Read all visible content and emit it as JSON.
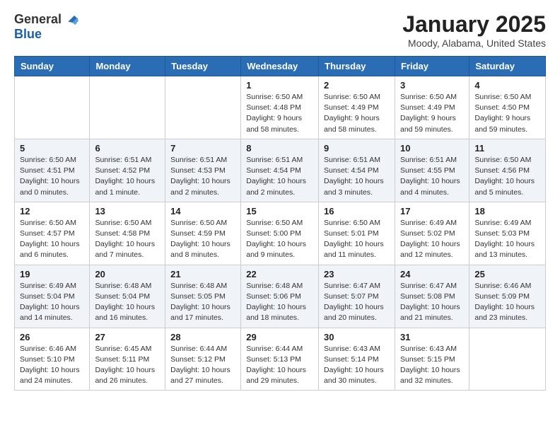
{
  "header": {
    "logo_general": "General",
    "logo_blue": "Blue",
    "title": "January 2025",
    "subtitle": "Moody, Alabama, United States"
  },
  "weekdays": [
    "Sunday",
    "Monday",
    "Tuesday",
    "Wednesday",
    "Thursday",
    "Friday",
    "Saturday"
  ],
  "weeks": [
    [
      {
        "day": "",
        "info": ""
      },
      {
        "day": "",
        "info": ""
      },
      {
        "day": "",
        "info": ""
      },
      {
        "day": "1",
        "info": "Sunrise: 6:50 AM\nSunset: 4:48 PM\nDaylight: 9 hours\nand 58 minutes."
      },
      {
        "day": "2",
        "info": "Sunrise: 6:50 AM\nSunset: 4:49 PM\nDaylight: 9 hours\nand 58 minutes."
      },
      {
        "day": "3",
        "info": "Sunrise: 6:50 AM\nSunset: 4:49 PM\nDaylight: 9 hours\nand 59 minutes."
      },
      {
        "day": "4",
        "info": "Sunrise: 6:50 AM\nSunset: 4:50 PM\nDaylight: 9 hours\nand 59 minutes."
      }
    ],
    [
      {
        "day": "5",
        "info": "Sunrise: 6:50 AM\nSunset: 4:51 PM\nDaylight: 10 hours\nand 0 minutes."
      },
      {
        "day": "6",
        "info": "Sunrise: 6:51 AM\nSunset: 4:52 PM\nDaylight: 10 hours\nand 1 minute."
      },
      {
        "day": "7",
        "info": "Sunrise: 6:51 AM\nSunset: 4:53 PM\nDaylight: 10 hours\nand 2 minutes."
      },
      {
        "day": "8",
        "info": "Sunrise: 6:51 AM\nSunset: 4:54 PM\nDaylight: 10 hours\nand 2 minutes."
      },
      {
        "day": "9",
        "info": "Sunrise: 6:51 AM\nSunset: 4:54 PM\nDaylight: 10 hours\nand 3 minutes."
      },
      {
        "day": "10",
        "info": "Sunrise: 6:51 AM\nSunset: 4:55 PM\nDaylight: 10 hours\nand 4 minutes."
      },
      {
        "day": "11",
        "info": "Sunrise: 6:50 AM\nSunset: 4:56 PM\nDaylight: 10 hours\nand 5 minutes."
      }
    ],
    [
      {
        "day": "12",
        "info": "Sunrise: 6:50 AM\nSunset: 4:57 PM\nDaylight: 10 hours\nand 6 minutes."
      },
      {
        "day": "13",
        "info": "Sunrise: 6:50 AM\nSunset: 4:58 PM\nDaylight: 10 hours\nand 7 minutes."
      },
      {
        "day": "14",
        "info": "Sunrise: 6:50 AM\nSunset: 4:59 PM\nDaylight: 10 hours\nand 8 minutes."
      },
      {
        "day": "15",
        "info": "Sunrise: 6:50 AM\nSunset: 5:00 PM\nDaylight: 10 hours\nand 9 minutes."
      },
      {
        "day": "16",
        "info": "Sunrise: 6:50 AM\nSunset: 5:01 PM\nDaylight: 10 hours\nand 11 minutes."
      },
      {
        "day": "17",
        "info": "Sunrise: 6:49 AM\nSunset: 5:02 PM\nDaylight: 10 hours\nand 12 minutes."
      },
      {
        "day": "18",
        "info": "Sunrise: 6:49 AM\nSunset: 5:03 PM\nDaylight: 10 hours\nand 13 minutes."
      }
    ],
    [
      {
        "day": "19",
        "info": "Sunrise: 6:49 AM\nSunset: 5:04 PM\nDaylight: 10 hours\nand 14 minutes."
      },
      {
        "day": "20",
        "info": "Sunrise: 6:48 AM\nSunset: 5:04 PM\nDaylight: 10 hours\nand 16 minutes."
      },
      {
        "day": "21",
        "info": "Sunrise: 6:48 AM\nSunset: 5:05 PM\nDaylight: 10 hours\nand 17 minutes."
      },
      {
        "day": "22",
        "info": "Sunrise: 6:48 AM\nSunset: 5:06 PM\nDaylight: 10 hours\nand 18 minutes."
      },
      {
        "day": "23",
        "info": "Sunrise: 6:47 AM\nSunset: 5:07 PM\nDaylight: 10 hours\nand 20 minutes."
      },
      {
        "day": "24",
        "info": "Sunrise: 6:47 AM\nSunset: 5:08 PM\nDaylight: 10 hours\nand 21 minutes."
      },
      {
        "day": "25",
        "info": "Sunrise: 6:46 AM\nSunset: 5:09 PM\nDaylight: 10 hours\nand 23 minutes."
      }
    ],
    [
      {
        "day": "26",
        "info": "Sunrise: 6:46 AM\nSunset: 5:10 PM\nDaylight: 10 hours\nand 24 minutes."
      },
      {
        "day": "27",
        "info": "Sunrise: 6:45 AM\nSunset: 5:11 PM\nDaylight: 10 hours\nand 26 minutes."
      },
      {
        "day": "28",
        "info": "Sunrise: 6:44 AM\nSunset: 5:12 PM\nDaylight: 10 hours\nand 27 minutes."
      },
      {
        "day": "29",
        "info": "Sunrise: 6:44 AM\nSunset: 5:13 PM\nDaylight: 10 hours\nand 29 minutes."
      },
      {
        "day": "30",
        "info": "Sunrise: 6:43 AM\nSunset: 5:14 PM\nDaylight: 10 hours\nand 30 minutes."
      },
      {
        "day": "31",
        "info": "Sunrise: 6:43 AM\nSunset: 5:15 PM\nDaylight: 10 hours\nand 32 minutes."
      },
      {
        "day": "",
        "info": ""
      }
    ]
  ]
}
